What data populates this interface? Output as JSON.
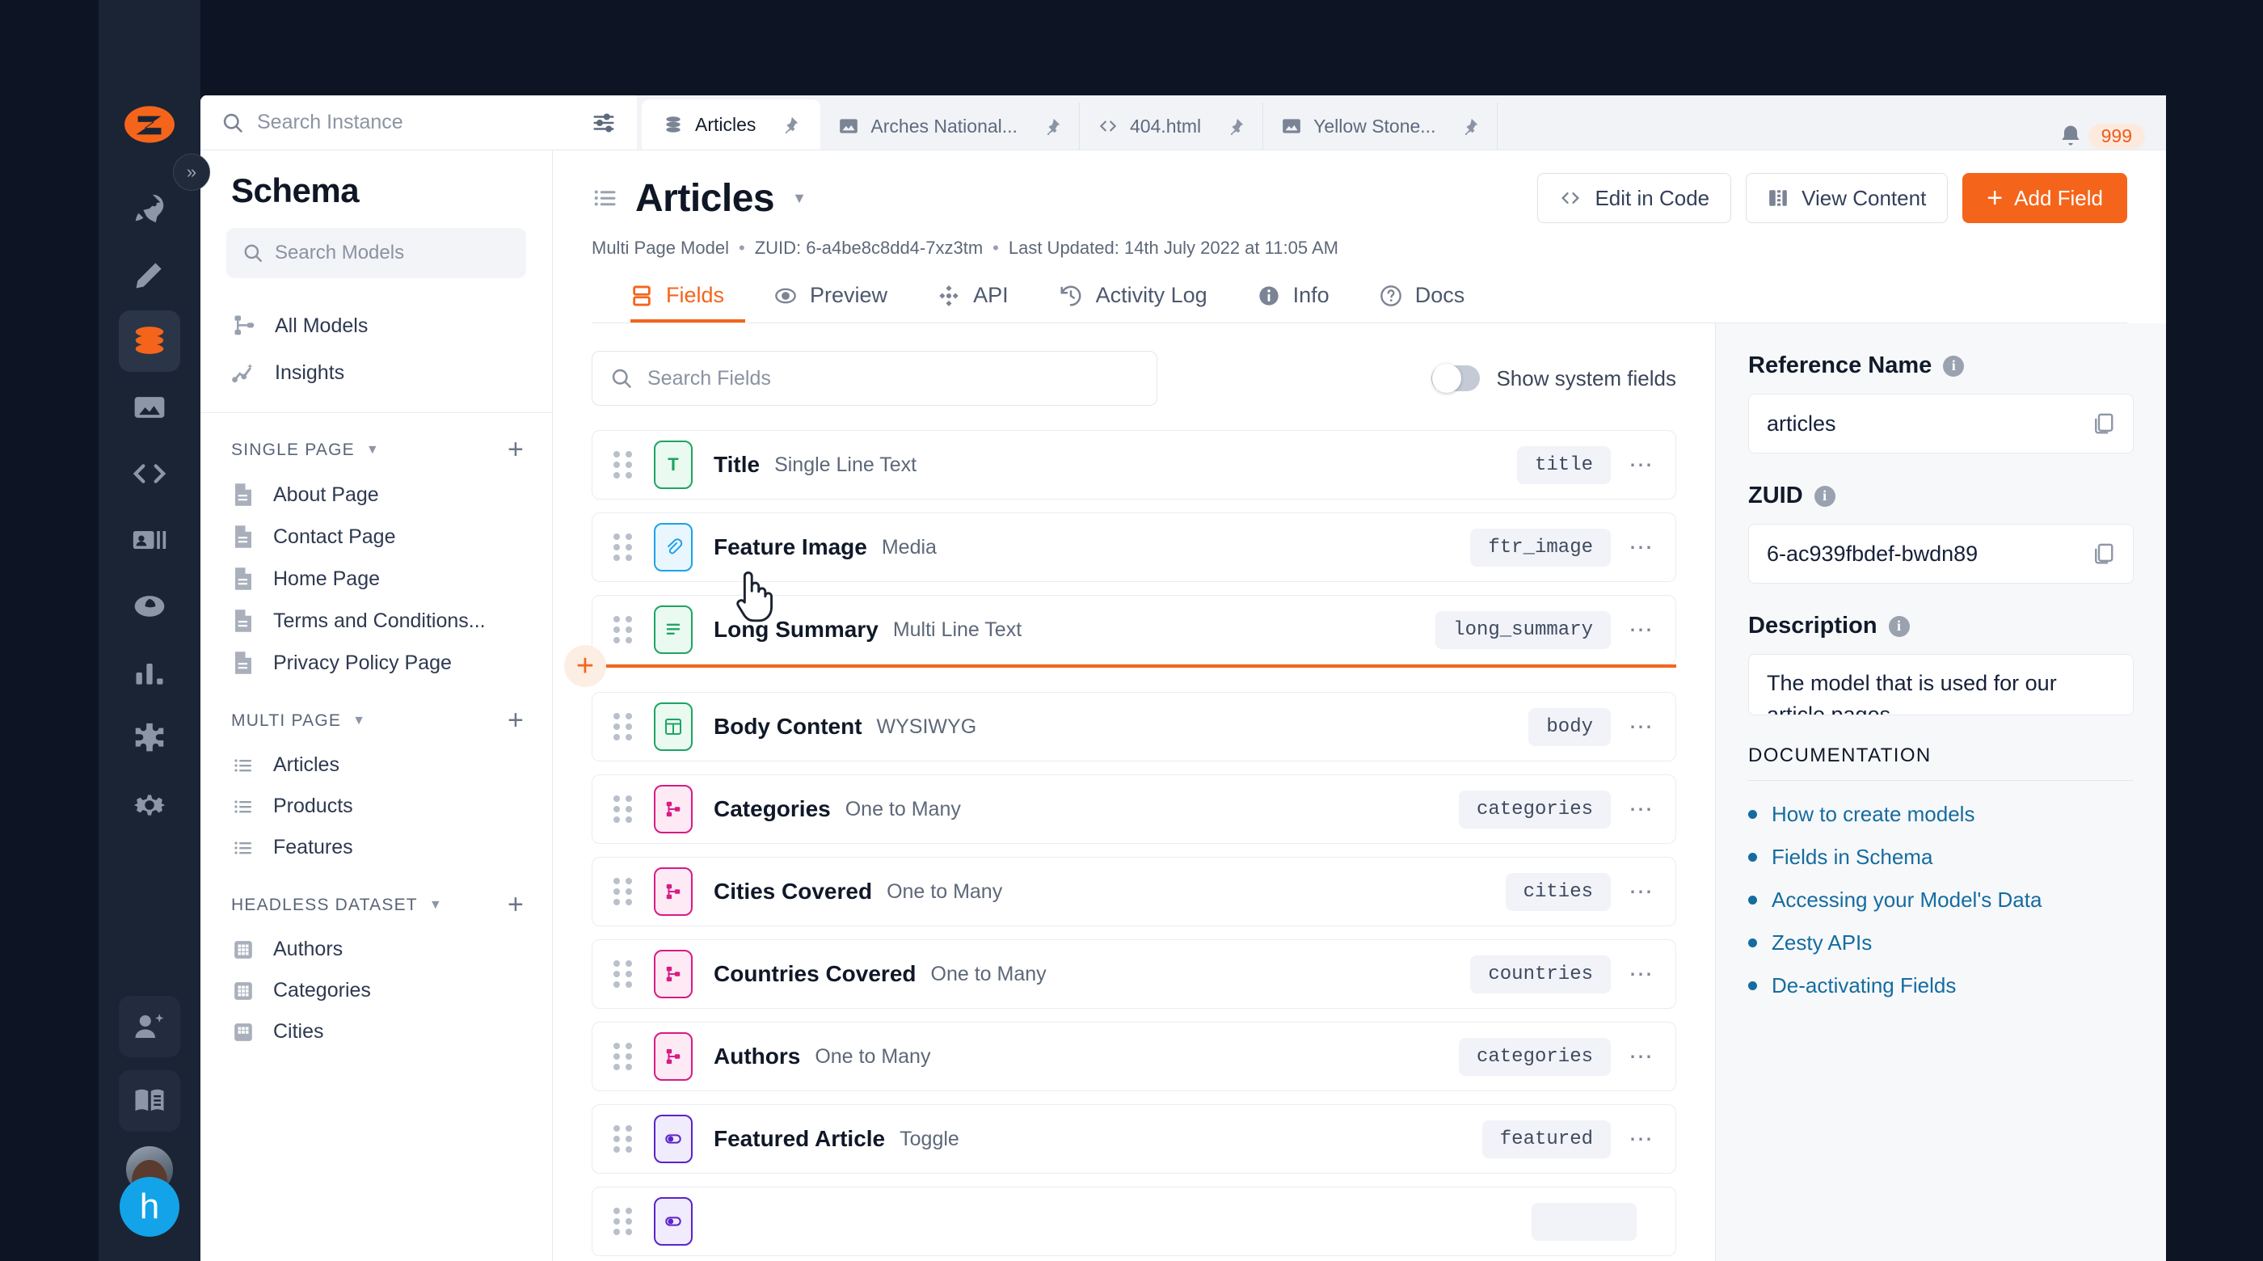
{
  "rail": {
    "logo": "zesty-logo-icon",
    "items": [
      {
        "name": "rocket-icon",
        "active": false
      },
      {
        "name": "pencil-icon",
        "active": false
      },
      {
        "name": "database-icon",
        "active": true
      },
      {
        "name": "media-image-icon",
        "active": false
      },
      {
        "name": "code-brackets-icon",
        "active": false
      },
      {
        "name": "contact-card-icon",
        "active": false
      },
      {
        "name": "audience-icon",
        "active": false
      },
      {
        "name": "bar-chart-icon",
        "active": false
      },
      {
        "name": "puzzle-icon",
        "active": false
      },
      {
        "name": "gear-icon",
        "active": false
      }
    ],
    "bottom": [
      {
        "name": "invite-user-icon"
      },
      {
        "name": "docs-book-icon"
      }
    ],
    "helper_letter": "h",
    "collapse_icon": "chevron-double-right-icon"
  },
  "topbar": {
    "search": {
      "placeholder": "Search Instance",
      "value": ""
    },
    "filter_icon": "sliders-icon",
    "tabs": [
      {
        "label": "Articles",
        "icon": "stack-icon",
        "active": true,
        "pinned": true
      },
      {
        "label": "Arches National...",
        "icon": "image-icon",
        "active": false,
        "pinned": true
      },
      {
        "label": "404.html",
        "icon": "code-icon",
        "active": false,
        "pinned": true
      },
      {
        "label": "Yellow Stone...",
        "icon": "image-icon",
        "active": false,
        "pinned": true
      }
    ],
    "bell_icon": "bell-icon",
    "notification_count": "999"
  },
  "sidebar": {
    "title": "Schema",
    "search": {
      "placeholder": "Search Models",
      "value": ""
    },
    "nav": [
      {
        "label": "All Models",
        "icon": "sitemap-icon"
      },
      {
        "label": "Insights",
        "icon": "insights-chart-icon"
      }
    ],
    "groups": [
      {
        "label": "SINGLE PAGE",
        "items": [
          {
            "label": "About Page",
            "icon": "page-icon"
          },
          {
            "label": "Contact Page",
            "icon": "page-icon"
          },
          {
            "label": "Home Page",
            "icon": "page-icon"
          },
          {
            "label": "Terms and Conditions...",
            "icon": "page-icon"
          },
          {
            "label": "Privacy Policy Page",
            "icon": "page-icon"
          }
        ]
      },
      {
        "label": "MULTI PAGE",
        "items": [
          {
            "label": "Articles",
            "icon": "list-icon"
          },
          {
            "label": "Products",
            "icon": "list-icon"
          },
          {
            "label": "Features",
            "icon": "list-icon"
          }
        ]
      },
      {
        "label": "HEADLESS DATASET",
        "items": [
          {
            "label": "Authors",
            "icon": "dataset-icon"
          },
          {
            "label": "Categories",
            "icon": "dataset-icon"
          },
          {
            "label": "Cities",
            "icon": "dataset-icon"
          }
        ]
      }
    ]
  },
  "main": {
    "title": "Articles",
    "title_icon": "list-icon",
    "title_caret": "chevron-down-icon",
    "actions": {
      "edit_in_code": "Edit in Code",
      "view_content": "View Content",
      "add_field": "Add Field"
    },
    "meta": {
      "model_type": "Multi Page Model",
      "zuid": "ZUID: 6-a4be8c8dd4-7xz3tm",
      "last_updated": "Last Updated: 14th July 2022 at 11:05 AM"
    },
    "tabs": [
      {
        "label": "Fields",
        "icon": "fields-icon",
        "active": true
      },
      {
        "label": "Preview",
        "icon": "eye-icon",
        "active": false
      },
      {
        "label": "API",
        "icon": "api-nodes-icon",
        "active": false
      },
      {
        "label": "Activity Log",
        "icon": "history-clock-icon",
        "active": false
      },
      {
        "label": "Info",
        "icon": "info-icon",
        "active": false
      },
      {
        "label": "Docs",
        "icon": "question-circle-icon",
        "active": false
      }
    ],
    "field_search": {
      "placeholder": "Search Fields",
      "value": ""
    },
    "show_system_fields": {
      "label": "Show system fields",
      "on": false
    },
    "fields": [
      {
        "name": "Title",
        "type": "Single Line Text",
        "key": "title",
        "color": "green",
        "icon": "T"
      },
      {
        "name": "Feature Image",
        "type": "Media",
        "key": "ftr_image",
        "color": "blue",
        "icon": "paperclip"
      },
      {
        "name": "Long Summary",
        "type": "Multi Line Text",
        "key": "long_summary",
        "color": "green",
        "icon": "lines"
      },
      {
        "name": "Body Content",
        "type": "WYSIWYG",
        "key": "body",
        "color": "green",
        "icon": "layout"
      },
      {
        "name": "Categories",
        "type": "One to Many",
        "key": "categories",
        "color": "pink",
        "icon": "relate"
      },
      {
        "name": "Cities Covered",
        "type": "One to Many",
        "key": "cities",
        "color": "pink",
        "icon": "relate"
      },
      {
        "name": "Countries Covered",
        "type": "One to Many",
        "key": "countries",
        "color": "pink",
        "icon": "relate"
      },
      {
        "name": "Authors",
        "type": "One to Many",
        "key": "categories",
        "color": "pink",
        "icon": "relate"
      },
      {
        "name": "Featured Article",
        "type": "Toggle",
        "key": "featured",
        "color": "purple",
        "icon": "toggle"
      }
    ],
    "drop_indicator": {
      "after_index": 2,
      "plus_icon": "plus-icon",
      "color": "#f4651b"
    }
  },
  "info_panel": {
    "reference_name": {
      "label": "Reference Name",
      "value": "articles",
      "copy_icon": "copy-icon"
    },
    "zuid": {
      "label": "ZUID",
      "value": "6-ac939fbdef-bwdn89",
      "copy_icon": "copy-icon"
    },
    "description": {
      "label": "Description",
      "value": "The model that is used for our article pages"
    },
    "documentation": {
      "heading": "DOCUMENTATION",
      "links": [
        "How to create models",
        "Fields in Schema",
        "Accessing your Model's Data",
        "Zesty APIs",
        "De-activating Fields"
      ]
    }
  },
  "colors": {
    "accent": "#f4651b",
    "link": "#156ca0",
    "rail_bg": "#1b2435",
    "desktop_bg": "#0d1423"
  }
}
